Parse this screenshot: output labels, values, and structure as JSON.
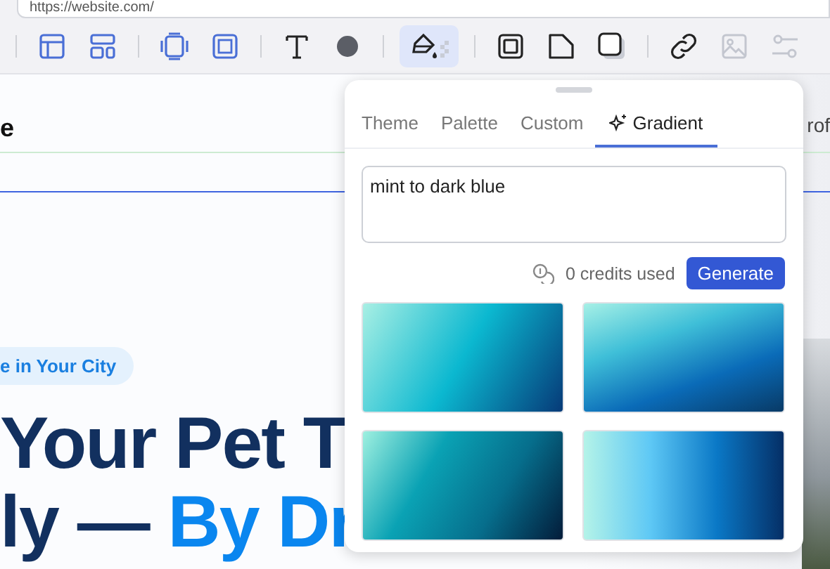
{
  "address_bar": {
    "url": "https://website.com/"
  },
  "toolbar": [
    {
      "kind": "divider"
    },
    {
      "kind": "table",
      "selected": false,
      "disabled": false
    },
    {
      "kind": "layout",
      "selected": false,
      "disabled": false
    },
    {
      "kind": "divider"
    },
    {
      "kind": "padding",
      "selected": false,
      "disabled": false
    },
    {
      "kind": "margin",
      "selected": false,
      "disabled": false
    },
    {
      "kind": "divider"
    },
    {
      "kind": "text",
      "selected": false,
      "disabled": false
    },
    {
      "kind": "dot",
      "selected": false,
      "disabled": false
    },
    {
      "kind": "divider"
    },
    {
      "kind": "fill",
      "selected": true,
      "disabled": false
    },
    {
      "kind": "divider"
    },
    {
      "kind": "border",
      "selected": false,
      "disabled": false
    },
    {
      "kind": "corner",
      "selected": false,
      "disabled": false
    },
    {
      "kind": "shadow",
      "selected": false,
      "disabled": false
    },
    {
      "kind": "divider"
    },
    {
      "kind": "link",
      "selected": false,
      "disabled": false
    },
    {
      "kind": "image",
      "selected": false,
      "disabled": true
    },
    {
      "kind": "sliders",
      "selected": false,
      "disabled": true
    }
  ],
  "page": {
    "nav_left": "e",
    "nav_right": "rof",
    "chip": "e in Your City",
    "headline_line_1": "Your Pet T",
    "headline_line_2": "ly — ",
    "headline_accent": "By Dr"
  },
  "popup": {
    "tabs": [
      {
        "label": "Theme",
        "selected": false,
        "kind": "plain"
      },
      {
        "label": "Palette",
        "selected": false,
        "kind": "plain"
      },
      {
        "label": "Custom",
        "selected": false,
        "kind": "plain"
      },
      {
        "label": "Gradient",
        "selected": true,
        "kind": "sparkle"
      }
    ],
    "prompt": {
      "value": "mint to dark blue"
    },
    "credits": "0 credits used",
    "generate_button": "Generate",
    "gradients": [
      {
        "kind": "diagonal"
      },
      {
        "kind": "steep"
      },
      {
        "kind": "deep"
      },
      {
        "kind": "horizontal"
      }
    ]
  }
}
